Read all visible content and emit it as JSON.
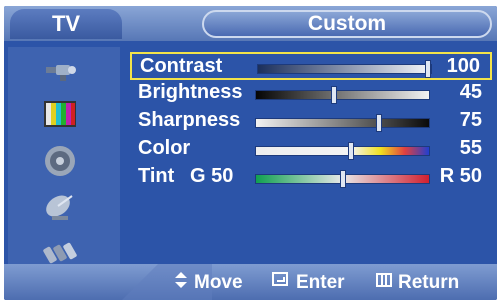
{
  "header": {
    "tab_label": "TV",
    "title": "Custom"
  },
  "sidebar": {
    "icons": [
      "antenna-icon",
      "color-bars-icon",
      "speaker-icon",
      "satellite-icon",
      "plugs-icon"
    ]
  },
  "menu": {
    "items": [
      {
        "label": "Contrast",
        "value": "100",
        "level": 1.0,
        "selected": true
      },
      {
        "label": "Brightness",
        "value": "45",
        "level": 0.45
      },
      {
        "label": "Sharpness",
        "value": "75",
        "level": 0.72
      },
      {
        "label": "Color",
        "value": "55",
        "level": 0.55
      },
      {
        "label": "Tint",
        "left_label": "G 50",
        "value": "R 50",
        "level": 0.5
      }
    ]
  },
  "footer": {
    "move_label": "Move",
    "enter_label": "Enter",
    "return_label": "Return"
  },
  "colors": {
    "background": "#2c54a8",
    "highlight": "#f2e34a"
  }
}
